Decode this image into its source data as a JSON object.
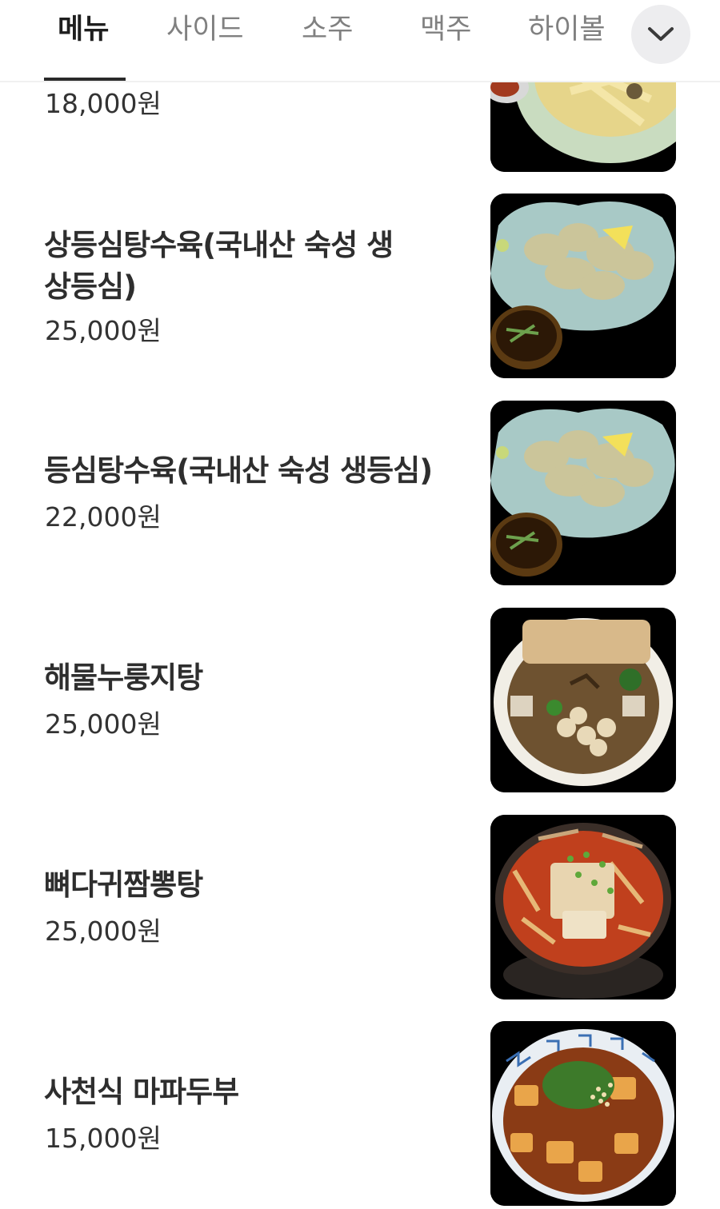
{
  "tabs": [
    {
      "label": "메뉴",
      "active": true
    },
    {
      "label": "사이드",
      "active": false
    },
    {
      "label": "소주",
      "active": false
    },
    {
      "label": "맥주",
      "active": false
    },
    {
      "label": "하이볼",
      "active": false
    }
  ],
  "expand_icon": "chevron-down-icon",
  "items": [
    {
      "name": "",
      "price": "18,000원"
    },
    {
      "name": "상등심탕수육(국내산 숙성 생상등심)",
      "price": "25,000원"
    },
    {
      "name": "등심탕수육(국내산 숙성 생등심)",
      "price": "22,000원"
    },
    {
      "name": "해물누룽지탕",
      "price": "25,000원"
    },
    {
      "name": "뼈다귀짬뽕탕",
      "price": "25,000원"
    },
    {
      "name": "사천식 마파두부",
      "price": "15,000원"
    }
  ]
}
